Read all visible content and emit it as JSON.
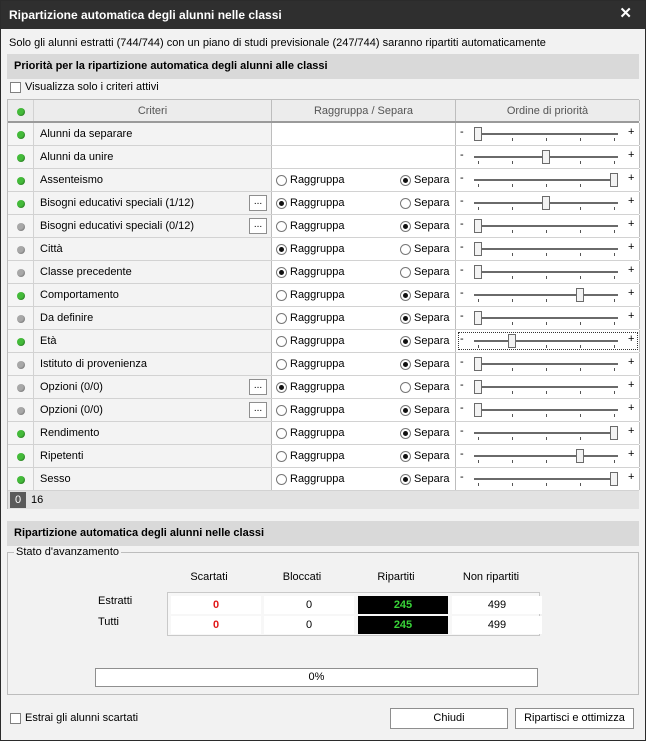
{
  "window": {
    "title": "Ripartizione automatica degli alunni nelle classi",
    "close_glyph": "✕"
  },
  "info_text": "Solo gli alunni estratti (744/744) con un piano di studi previsionale (247/744) saranno ripartiti automaticamente",
  "priority_section": {
    "title": "Priorità per la ripartizione automatica degli alunni alle classi",
    "show_active_label": "Visualizza solo i criteri attivi",
    "show_active_checked": false
  },
  "grid": {
    "headers": {
      "criteria": "Criteri",
      "group_separate": "Raggruppa / Separa",
      "priority": "Ordine di priorità"
    },
    "minus": "-",
    "plus": "+",
    "ellipsis": "...",
    "group_label": "Raggruppa",
    "separate_label": "Separa",
    "rows": [
      {
        "name": "Alunni da separare",
        "status": "green",
        "ellipsis": false,
        "choice": null,
        "priority": 0.0
      },
      {
        "name": "Alunni da unire",
        "status": "green",
        "ellipsis": false,
        "choice": null,
        "priority": 0.5
      },
      {
        "name": "Assenteismo",
        "status": "green",
        "ellipsis": false,
        "choice": "separa",
        "priority": 1.0
      },
      {
        "name": "Bisogni educativi speciali (1/12)",
        "status": "green",
        "ellipsis": true,
        "choice": "raggruppa",
        "priority": 0.5
      },
      {
        "name": "Bisogni educativi speciali (0/12)",
        "status": "gray",
        "ellipsis": true,
        "choice": "separa",
        "priority": 0.0
      },
      {
        "name": "Città",
        "status": "gray",
        "ellipsis": false,
        "choice": "raggruppa",
        "priority": 0.0
      },
      {
        "name": "Classe precedente",
        "status": "gray",
        "ellipsis": false,
        "choice": "raggruppa",
        "priority": 0.0
      },
      {
        "name": "Comportamento",
        "status": "green",
        "ellipsis": false,
        "choice": "separa",
        "priority": 0.75
      },
      {
        "name": "Da definire",
        "status": "gray",
        "ellipsis": false,
        "choice": "separa",
        "priority": 0.0
      },
      {
        "name": "Età",
        "status": "green",
        "ellipsis": false,
        "choice": "separa",
        "priority": 0.25,
        "focused": true
      },
      {
        "name": "Istituto di provenienza",
        "status": "gray",
        "ellipsis": false,
        "choice": "separa",
        "priority": 0.0
      },
      {
        "name": "Opzioni (0/0)",
        "status": "gray",
        "ellipsis": true,
        "choice": "raggruppa",
        "priority": 0.0
      },
      {
        "name": "Opzioni (0/0)",
        "status": "gray",
        "ellipsis": true,
        "choice": "separa",
        "priority": 0.0
      },
      {
        "name": "Rendimento",
        "status": "green",
        "ellipsis": false,
        "choice": "separa",
        "priority": 1.0
      },
      {
        "name": "Ripetenti",
        "status": "green",
        "ellipsis": false,
        "choice": "separa",
        "priority": 0.75
      },
      {
        "name": "Sesso",
        "status": "green",
        "ellipsis": false,
        "choice": "separa",
        "priority": 1.0
      }
    ],
    "pager": [
      "0",
      "16"
    ]
  },
  "distribution_section": {
    "title": "Ripartizione automatica degli alunni nelle classi",
    "progress_group": "Stato d'avanzamento",
    "columns": [
      "Scartati",
      "Bloccati",
      "Ripartiti",
      "Non ripartiti"
    ],
    "rows": [
      {
        "label": "Estratti",
        "values": [
          "0",
          "0",
          "245",
          "499"
        ]
      },
      {
        "label": "Tutti",
        "values": [
          "0",
          "0",
          "245",
          "499"
        ]
      }
    ],
    "progress_text": "0%",
    "progress_value": 0
  },
  "footer": {
    "extract_discarded_label": "Estrai gli alunni scartati",
    "extract_discarded_checked": false,
    "close_button": "Chiudi",
    "distribute_button": "Ripartisci e ottimizza"
  },
  "colors": {
    "active": "#44bb3a",
    "inactive": "#a8a8a8",
    "discarded": "#e01818",
    "distributed_text": "#39d339"
  }
}
